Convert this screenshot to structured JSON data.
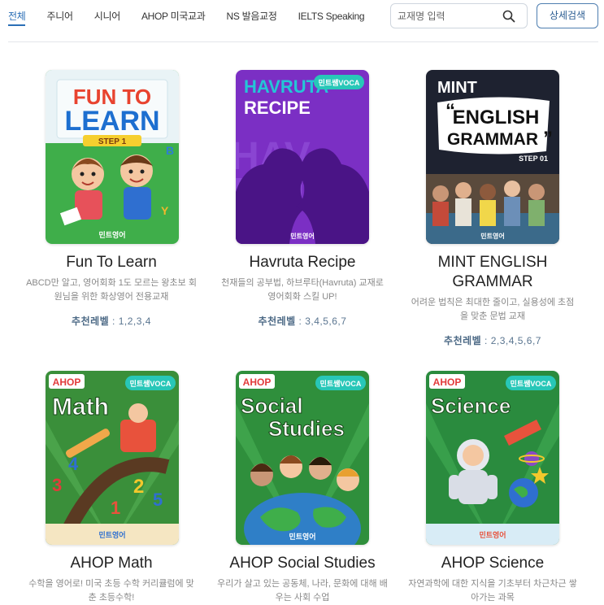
{
  "tabs": [
    {
      "label": "전체",
      "active": true
    },
    {
      "label": "주니어",
      "active": false
    },
    {
      "label": "시니어",
      "active": false
    },
    {
      "label": "AHOP 미국교과",
      "active": false
    },
    {
      "label": "NS 발음교정",
      "active": false
    },
    {
      "label": "IELTS Speaking",
      "active": false
    }
  ],
  "search": {
    "placeholder": "교재명 입력",
    "value": ""
  },
  "advanced_search_label": "상세검색",
  "level_label": "추천레벨",
  "books": [
    {
      "title": "Fun To Learn",
      "description": "ABCD만 알고, 영어회화 1도 모르는 왕초보 회원님을 위한 화상영어 전용교재",
      "levels": "1,2,3,4",
      "cover": {
        "line1": "FUN TO",
        "line2": "LEARN",
        "step": "STEP 1",
        "publisher": "민트영어",
        "bg": "#3fae4a"
      }
    },
    {
      "title": "Havruta Recipe",
      "description": "천재들의 공부법, 하브루타(Havruta) 교재로 영어회화 스킬 UP!",
      "levels": "3,4,5,6,7",
      "cover": {
        "line1": "HAVRUTA",
        "line2": "RECIPE",
        "badge": "민트쌤VOCA",
        "publisher": "민트영어",
        "bg": "#7b2fc4"
      }
    },
    {
      "title": "MINT ENGLISH GRAMMAR",
      "description": "어려운 법칙은 최대한 줄이고, 실용성에 초점을 맞춘 문법 교재",
      "levels": "2,3,4,5,6,7",
      "cover": {
        "line1": "MINT",
        "line2": "ENGLISH",
        "line3": "GRAMMAR",
        "step": "STEP 01",
        "publisher": "민트영어",
        "bg": "#1e2230"
      }
    },
    {
      "title": "AHOP Math",
      "description": "수학을 영어로! 미국 초등 수학 커리큘럼에 맞춘 초등수학!",
      "levels": "",
      "cover": {
        "brand": "AHOP",
        "subject": "Math",
        "badge": "민트쌤VOCA",
        "publisher": "민트영어",
        "bg": "#3a8f3a"
      }
    },
    {
      "title": "AHOP Social Studies",
      "description": "우리가 살고 있는 공동체, 나라, 문화에 대해 배우는 사회 수업",
      "levels": "",
      "cover": {
        "brand": "AHOP",
        "subject1": "Social",
        "subject2": "Studies",
        "badge": "민트쌤VOCA",
        "publisher": "민트영어",
        "bg": "#2f8f3c"
      }
    },
    {
      "title": "AHOP Science",
      "description": "자연과학에 대한 지식을 기초부터 차근차근 쌓아가는 과목",
      "levels": "",
      "cover": {
        "brand": "AHOP",
        "subject": "Science",
        "badge": "민트쌤VOCA",
        "publisher": "민트영어",
        "bg": "#2a8b3e"
      }
    }
  ]
}
